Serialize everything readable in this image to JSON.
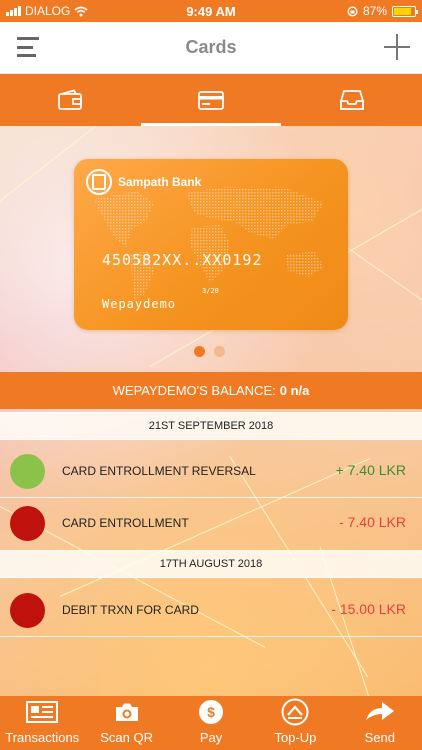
{
  "status_bar": {
    "carrier": "DIALOG",
    "time": "9:49 AM",
    "battery": "87%",
    "battery_level": 0.87
  },
  "header": {
    "title": "Cards",
    "menu_icon": "hamburger-menu-icon",
    "add_icon": "plus-icon"
  },
  "tabs": [
    {
      "icon": "wallet-icon",
      "active": false
    },
    {
      "icon": "credit-card-icon",
      "active": true
    },
    {
      "icon": "inbox-tray-icon",
      "active": false
    }
  ],
  "card": {
    "bank_name": "Sampath Bank",
    "number": "450582XX..XX0192",
    "expiry": "3/20",
    "holder": "Wepaydemo"
  },
  "carousel": {
    "count": 2,
    "active_index": 0
  },
  "balance": {
    "label": "WEPAYDEMO'S BALANCE:",
    "value": "0 n/a"
  },
  "transactions": {
    "groups": [
      {
        "date": "21ST SEPTEMBER 2018",
        "items": [
          {
            "description": "CARD ENTROLLMENT REVERSAL",
            "amount": "+ 7.40 LKR",
            "type": "credit"
          },
          {
            "description": "CARD ENTROLLMENT",
            "amount": "- 7.40 LKR",
            "type": "debit"
          }
        ]
      },
      {
        "date": "17TH AUGUST 2018",
        "items": [
          {
            "description": "DEBIT TRXN FOR CARD",
            "amount": "- 15.00 LKR",
            "type": "debit"
          }
        ]
      }
    ]
  },
  "bottom_nav": [
    {
      "label": "Transactions",
      "icon": "transactions-icon"
    },
    {
      "label": "Scan QR",
      "icon": "camera-icon"
    },
    {
      "label": "Pay",
      "icon": "dollar-coin-icon"
    },
    {
      "label": "Top-Up",
      "icon": "top-up-icon"
    },
    {
      "label": "Send",
      "icon": "send-arrow-icon"
    }
  ],
  "colors": {
    "accent": "#f07a24",
    "credit": "#3b8f2e",
    "debit": "#e64040",
    "credit_dot": "#8bc34a",
    "debit_dot": "#c0120c"
  }
}
